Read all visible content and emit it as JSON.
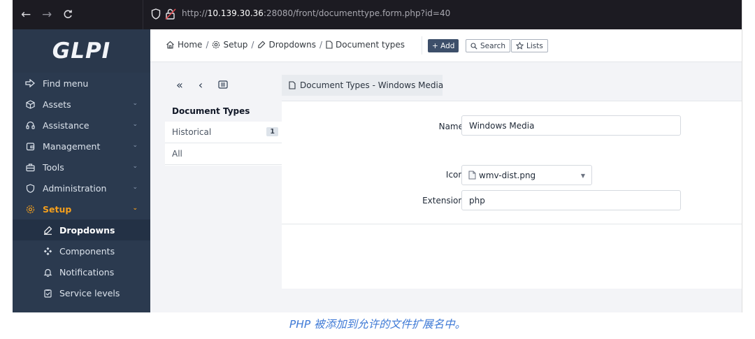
{
  "browser": {
    "back_label": "←",
    "forward_label": "→",
    "reload_label": "C",
    "url_prefix": "http://",
    "url_host": "10.139.30.36",
    "url_rest": ":28080/front/documenttype.form.php?id=40"
  },
  "sidebar": {
    "logo": "GLPI",
    "items": [
      {
        "label": "Find menu",
        "icon": "arrow-right-icon",
        "chevron": false
      },
      {
        "label": "Assets",
        "icon": "box-icon",
        "chevron": true
      },
      {
        "label": "Assistance",
        "icon": "headset-icon",
        "chevron": true
      },
      {
        "label": "Management",
        "icon": "wallet-icon",
        "chevron": true
      },
      {
        "label": "Tools",
        "icon": "briefcase-icon",
        "chevron": true
      },
      {
        "label": "Administration",
        "icon": "shield-icon",
        "chevron": true
      },
      {
        "label": "Setup",
        "icon": "settings-icon",
        "chevron": true
      }
    ],
    "subitems": [
      {
        "label": "Dropdowns",
        "icon": "edit-icon"
      },
      {
        "label": "Components",
        "icon": "components-icon"
      },
      {
        "label": "Notifications",
        "icon": "bell-icon"
      },
      {
        "label": "Service levels",
        "icon": "checklist-icon"
      }
    ],
    "accent_color": "#f59f1c"
  },
  "topbar": {
    "breadcrumb": [
      "Home",
      "Setup",
      "Dropdowns",
      "Document types"
    ],
    "separator": "/",
    "add_label": "+ Add",
    "search_label": "Search",
    "lists_label": "Lists"
  },
  "record": {
    "title": "Document Types - Windows Media",
    "tabs": [
      {
        "label": "Document Types",
        "badge": ""
      },
      {
        "label": "Historical",
        "badge": "1"
      },
      {
        "label": "All",
        "badge": ""
      }
    ]
  },
  "form": {
    "name_label": "Name",
    "name_value": "Windows Media",
    "icon_label": "Icon",
    "icon_value": "wmv-dist.png",
    "extension_label": "Extension",
    "extension_value": "php"
  },
  "caption": "PHP 被添加到允许的文件扩展名中。"
}
